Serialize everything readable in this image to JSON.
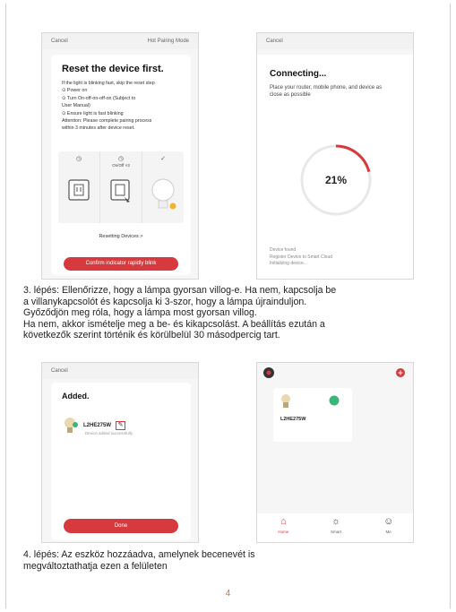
{
  "page_number": "4",
  "shot1": {
    "topbar_left": "Cancel",
    "topbar_right": "Hot Pairing Mode",
    "title": "Reset the device first.",
    "lines": [
      "If the light is blinking fast, skip the reset step",
      "⊙ Power on",
      "⊙ Turn On-off-on-off-on (Subject to",
      "User Manual)",
      "⊙ Ensure light is fast blinking",
      "Attention: Please complete pairing process",
      "within 3 minutes after device reset."
    ],
    "step2_sub": "On/Off ×3",
    "resetting_link": "Resetting Devices >",
    "confirm_button": "Confirm indicator rapidly blink",
    "accent_color": "#d63a3f"
  },
  "shot2": {
    "topbar_left": "Cancel",
    "title": "Connecting...",
    "subtitle": "Place your router, mobile phone, and device as close as possible",
    "progress_value": 0.21,
    "progress_label": "21%",
    "status_lines": [
      "Device found",
      "Register Device to Smart Cloud",
      "Initializing device..."
    ]
  },
  "paragraph1": [
    "3. lépés: Ellenőrizze, hogy a lámpa gyorsan villog-e. Ha nem, kapcsolja be",
    "a villanykapcsolót és kapcsolja ki 3-szor, hogy a lámpa újrainduljon.",
    "Győződjön meg róla, hogy a lámpa most gyorsan villog.",
    "Ha nem, akkor ismételje meg a be- és kikapcsolást. A beállítás ezután a",
    "következők szerint történik és körülbelül 30 másodpercig tart."
  ],
  "shot3": {
    "topbar_left": "Cancel",
    "title": "Added.",
    "device_name": "L2HE275W",
    "device_status": "Device added successfully",
    "done_button": "Done"
  },
  "shot4": {
    "device_name": "L2HE275W",
    "tabs": [
      {
        "label": "Home",
        "icon": "home-icon"
      },
      {
        "label": "Smart",
        "icon": "smart-icon"
      },
      {
        "label": "Me",
        "icon": "me-icon"
      }
    ]
  },
  "paragraph2": [
    "4. lépés: Az eszköz hozzáadva, amelynek becenevét is",
    "megváltoztathatja ezen a felületen"
  ]
}
